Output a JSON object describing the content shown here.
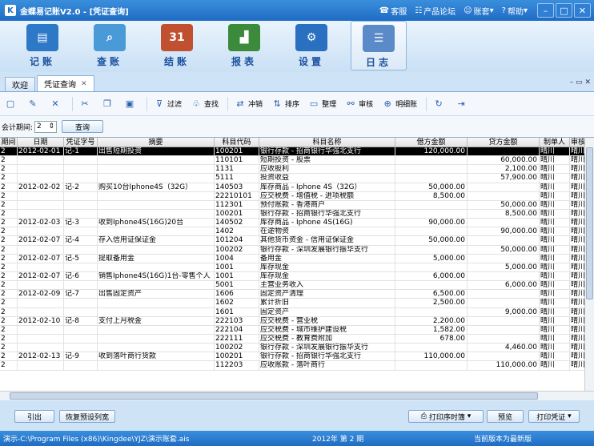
{
  "window": {
    "title": "金蝶易记账V2.0 - [凭证查询]",
    "links": [
      {
        "label": "客服",
        "icon": "headset-icon"
      },
      {
        "label": "产品论坛",
        "icon": "forum-icon"
      },
      {
        "label": "账套",
        "icon": "account-set-icon"
      },
      {
        "label": "帮助",
        "icon": "help-icon"
      }
    ]
  },
  "ribbon": {
    "items": [
      {
        "label": "记账",
        "icon": "bookkeeping-icon",
        "color": "#2e78c8"
      },
      {
        "label": "查账",
        "icon": "search-ledger-icon",
        "color": "#4a9ad8"
      },
      {
        "label": "结账",
        "icon": "calendar-icon",
        "color": "#c05030"
      },
      {
        "label": "报表",
        "icon": "chart-icon",
        "color": "#3c8a3c"
      },
      {
        "label": "设置",
        "icon": "gear-icon",
        "color": "#2a70c0"
      },
      {
        "label": "日志",
        "icon": "log-icon",
        "color": "#5a8ac8"
      }
    ]
  },
  "tabs": [
    {
      "label": "欢迎"
    },
    {
      "label": "凭证查询"
    }
  ],
  "toolbar": {
    "items": [
      {
        "label": "",
        "icon": "new-doc-icon"
      },
      {
        "label": "",
        "icon": "edit-icon"
      },
      {
        "label": "",
        "icon": "delete-icon"
      },
      {
        "label": "",
        "icon": "cut-icon"
      },
      {
        "label": "",
        "icon": "copy-icon"
      },
      {
        "label": "",
        "icon": "paste-icon"
      },
      {
        "label": "过滤",
        "icon": "filter-icon"
      },
      {
        "label": "查找",
        "icon": "find-icon"
      },
      {
        "label": "冲销",
        "icon": "reverse-icon"
      },
      {
        "label": "排序",
        "icon": "sort-icon"
      },
      {
        "label": "整理",
        "icon": "organize-icon"
      },
      {
        "label": "审核",
        "icon": "audit-icon"
      },
      {
        "label": "明细账",
        "icon": "detail-ledger-icon"
      },
      {
        "label": "",
        "icon": "refresh-icon"
      },
      {
        "label": "",
        "icon": "exit-icon"
      }
    ]
  },
  "period": {
    "label": "会计期间:",
    "value": "2",
    "query_label": "查询"
  },
  "grid": {
    "headers": [
      "期间",
      "日期",
      "凭证字号",
      "摘要",
      "科目代码",
      "科目名称",
      "借方金额",
      "贷方金额",
      "制单人",
      "审核人"
    ],
    "rows": [
      {
        "p": "2",
        "date": "2012-02-01",
        "no": "记-1",
        "summary": "出售短期投资",
        "code": "100201",
        "name": "银行存款 - 招商银行华强北支行",
        "debit": "120,000.00",
        "credit": "",
        "maker": "晴川",
        "auditor": "晴川"
      },
      {
        "p": "2",
        "date": "",
        "no": "",
        "summary": "",
        "code": "110101",
        "name": "短期投资 - 股票",
        "debit": "",
        "credit": "60,000.00",
        "maker": "晴川",
        "auditor": "晴川"
      },
      {
        "p": "2",
        "date": "",
        "no": "",
        "summary": "",
        "code": "1131",
        "name": "应收股利",
        "debit": "",
        "credit": "2,100.00",
        "maker": "晴川",
        "auditor": "晴川"
      },
      {
        "p": "2",
        "date": "",
        "no": "",
        "summary": "",
        "code": "5111",
        "name": "投资收益",
        "debit": "",
        "credit": "57,900.00",
        "maker": "晴川",
        "auditor": "晴川"
      },
      {
        "p": "2",
        "date": "2012-02-02",
        "no": "记-2",
        "summary": "购买10台Iphone4S（32G）",
        "code": "140503",
        "name": "库存商品 - Iphone 4S（32G）",
        "debit": "50,000.00",
        "credit": "",
        "maker": "晴川",
        "auditor": "晴川"
      },
      {
        "p": "2",
        "date": "",
        "no": "",
        "summary": "",
        "code": "22210101",
        "name": "应交税费 - 增值税 - 进项税额",
        "debit": "8,500.00",
        "credit": "",
        "maker": "晴川",
        "auditor": "晴川"
      },
      {
        "p": "2",
        "date": "",
        "no": "",
        "summary": "",
        "code": "112301",
        "name": "预付账款 - 香港商户",
        "debit": "",
        "credit": "50,000.00",
        "maker": "晴川",
        "auditor": "晴川"
      },
      {
        "p": "2",
        "date": "",
        "no": "",
        "summary": "",
        "code": "100201",
        "name": "银行存款 - 招商银行华强北支行",
        "debit": "",
        "credit": "8,500.00",
        "maker": "晴川",
        "auditor": "晴川"
      },
      {
        "p": "2",
        "date": "2012-02-03",
        "no": "记-3",
        "summary": "收到Iphone4S(16G)20台",
        "code": "140502",
        "name": "库存商品 - Iphone 4S(16G)",
        "debit": "90,000.00",
        "credit": "",
        "maker": "晴川",
        "auditor": "晴川"
      },
      {
        "p": "2",
        "date": "",
        "no": "",
        "summary": "",
        "code": "1402",
        "name": "在途物资",
        "debit": "",
        "credit": "90,000.00",
        "maker": "晴川",
        "auditor": "晴川"
      },
      {
        "p": "2",
        "date": "2012-02-07",
        "no": "记-4",
        "summary": "存入信用证保证金",
        "code": "101204",
        "name": "其他货币资金 - 信用证保证金",
        "debit": "50,000.00",
        "credit": "",
        "maker": "晴川",
        "auditor": "晴川"
      },
      {
        "p": "2",
        "date": "",
        "no": "",
        "summary": "",
        "code": "100202",
        "name": "银行存款 - 深圳发展银行振华支行",
        "debit": "",
        "credit": "50,000.00",
        "maker": "晴川",
        "auditor": "晴川"
      },
      {
        "p": "2",
        "date": "2012-02-07",
        "no": "记-5",
        "summary": "提取备用金",
        "code": "1004",
        "name": "备用金",
        "debit": "5,000.00",
        "credit": "",
        "maker": "晴川",
        "auditor": "晴川"
      },
      {
        "p": "2",
        "date": "",
        "no": "",
        "summary": "",
        "code": "1001",
        "name": "库存现金",
        "debit": "",
        "credit": "5,000.00",
        "maker": "晴川",
        "auditor": "晴川"
      },
      {
        "p": "2",
        "date": "2012-02-07",
        "no": "记-6",
        "summary": "销售Iphone4S(16G)1台-零售个人",
        "code": "1001",
        "name": "库存现金",
        "debit": "6,000.00",
        "credit": "",
        "maker": "晴川",
        "auditor": "晴川"
      },
      {
        "p": "2",
        "date": "",
        "no": "",
        "summary": "",
        "code": "5001",
        "name": "主营业务收入",
        "debit": "",
        "credit": "6,000.00",
        "maker": "晴川",
        "auditor": "晴川"
      },
      {
        "p": "2",
        "date": "2012-02-09",
        "no": "记-7",
        "summary": "出售固定资产",
        "code": "1606",
        "name": "固定资产清理",
        "debit": "6,500.00",
        "credit": "",
        "maker": "晴川",
        "auditor": "晴川"
      },
      {
        "p": "2",
        "date": "",
        "no": "",
        "summary": "",
        "code": "1602",
        "name": "累计折旧",
        "debit": "2,500.00",
        "credit": "",
        "maker": "晴川",
        "auditor": "晴川"
      },
      {
        "p": "2",
        "date": "",
        "no": "",
        "summary": "",
        "code": "1601",
        "name": "固定资产",
        "debit": "",
        "credit": "9,000.00",
        "maker": "晴川",
        "auditor": "晴川"
      },
      {
        "p": "2",
        "date": "2012-02-10",
        "no": "记-8",
        "summary": "支付上月税金",
        "code": "222103",
        "name": "应交税费 - 营业税",
        "debit": "2,200.00",
        "credit": "",
        "maker": "晴川",
        "auditor": "晴川"
      },
      {
        "p": "2",
        "date": "",
        "no": "",
        "summary": "",
        "code": "222104",
        "name": "应交税费 - 城市维护建设税",
        "debit": "1,582.00",
        "credit": "",
        "maker": "晴川",
        "auditor": "晴川"
      },
      {
        "p": "2",
        "date": "",
        "no": "",
        "summary": "",
        "code": "222111",
        "name": "应交税费 - 教育费附加",
        "debit": "678.00",
        "credit": "",
        "maker": "晴川",
        "auditor": "晴川"
      },
      {
        "p": "2",
        "date": "",
        "no": "",
        "summary": "",
        "code": "100202",
        "name": "银行存款 - 深圳发展银行振华支行",
        "debit": "",
        "credit": "4,460.00",
        "maker": "晴川",
        "auditor": "晴川"
      },
      {
        "p": "2",
        "date": "2012-02-13",
        "no": "记-9",
        "summary": "收到落叶商行货款",
        "code": "100201",
        "name": "银行存款 - 招商银行华强北支行",
        "debit": "110,000.00",
        "credit": "",
        "maker": "晴川",
        "auditor": "晴川"
      },
      {
        "p": "2",
        "date": "",
        "no": "",
        "summary": "",
        "code": "112203",
        "name": "应收账款 - 落叶商行",
        "debit": "",
        "credit": "110,000.00",
        "maker": "晴川",
        "auditor": "晴川"
      }
    ]
  },
  "bottom": {
    "btn1": "引出",
    "btn2": "恢复预设列宽",
    "btn3": "打印序时簿",
    "btn4": "预览",
    "btn5": "打印凭证"
  },
  "status": {
    "path": "演示-C:\\Program Files (x86)\\Kingdee\\YJZ\\演示账套.ais",
    "period": "2012年 第 2 期",
    "version": "当前版本为最新版"
  }
}
